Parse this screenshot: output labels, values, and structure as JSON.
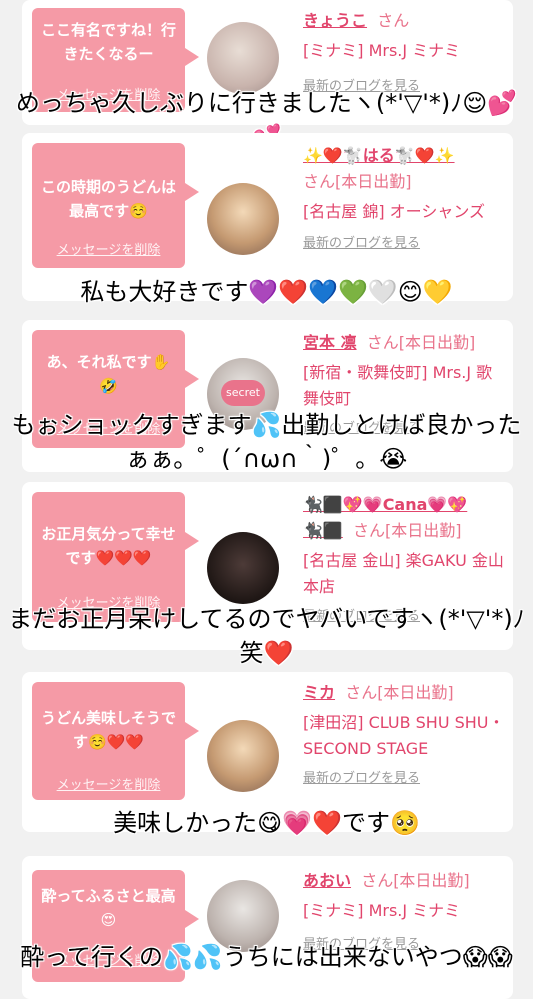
{
  "messages": [
    {
      "bubble": "ここ有名ですね！行きたくなるー",
      "delete_label": "メッセージを削除",
      "name": "きょうこ",
      "san": "さん",
      "detail": "[ミナミ] Mrs.J ミナミ",
      "blog": "最新のブログを見る",
      "caption": "めっちゃ久しぶりに行きましたヽ(*'▽'*)ﾉ😌💕💕"
    },
    {
      "bubble": "この時期のうどんは最高です☺️",
      "delete_label": "メッセージを削除",
      "name": "✨❤️🐩はる🐩❤️✨",
      "san": "さん[本日出勤]",
      "detail": "[名古屋 錦] オーシャンズ",
      "blog": "最新のブログを見る",
      "caption": "私も大好きです💜❤️💙💚🤍😊💛"
    },
    {
      "bubble": "あ、それ私です✋🤣",
      "delete_label": "メッセージを削除",
      "avatar_label": "secret",
      "name": "宮本 凛",
      "san": "さん[本日出勤]",
      "detail": "[新宿・歌舞伎町] Mrs.J 歌舞伎町",
      "blog": "最新のブログを見る",
      "caption": "もぉショックすぎます💦出勤しとけば良かったぁぁ。゜(´∩ω∩｀)゜。😭"
    },
    {
      "bubble": "お正月気分って幸せです❤️❤️❤️",
      "delete_label": "メッセージを削除",
      "name": "🐈‍⬛⬛💖💗Cana💗💖",
      "name2": "🐈‍⬛⬛",
      "san": "さん[本日出勤]",
      "detail": "[名古屋 金山] 楽GAKU 金山本店",
      "blog": "最新のブログを見る",
      "caption": "まだお正月呆けしてるのでヤバいですヽ(*'▽'*)ﾉ笑❤️"
    },
    {
      "bubble": "うどん美味しそうです☺️❤️❤️",
      "delete_label": "メッセージを削除",
      "name": "ミカ",
      "san": "さん[本日出勤]",
      "detail": "[津田沼] CLUB SHU SHU・SECOND STAGE",
      "blog": "最新のブログを見る",
      "caption": "美味しかった😋💗❤️です🥺"
    },
    {
      "bubble": "酔ってふるさと最高😍",
      "delete_label": "メッセージを削除",
      "name": "あおい",
      "san": "さん[本日出勤]",
      "detail": "[ミナミ] Mrs.J ミナミ",
      "blog": "最新のブログを見る",
      "caption": "酔って行くの💦💦うちには出来ないやつ😱😱"
    }
  ]
}
